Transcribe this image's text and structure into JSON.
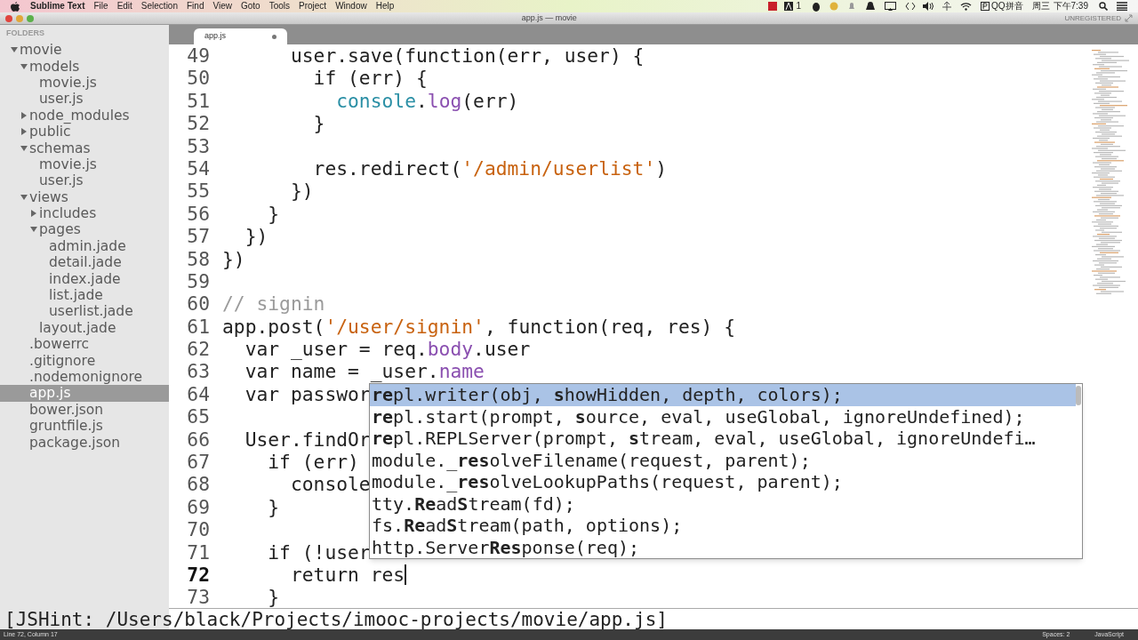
{
  "menu_bar": {
    "app": "Sublime Text",
    "items": [
      "File",
      "Edit",
      "Selection",
      "Find",
      "View",
      "Goto",
      "Tools",
      "Project",
      "Window",
      "Help"
    ],
    "tray_badge": "1",
    "input_method": "QQ拼音",
    "day": "周三",
    "time": "下午7:39"
  },
  "window": {
    "title": "app.js — movie",
    "license": "UNREGISTERED"
  },
  "sidebar": {
    "header": "FOLDERS",
    "items": [
      {
        "label": "movie",
        "kind": "folder",
        "expanded": true,
        "selected": false,
        "children": [
          {
            "label": "models",
            "kind": "folder",
            "expanded": true,
            "selected": false,
            "children": [
              {
                "label": "movie.js",
                "kind": "file",
                "selected": false
              },
              {
                "label": "user.js",
                "kind": "file",
                "selected": false
              }
            ]
          },
          {
            "label": "node_modules",
            "kind": "folder",
            "expanded": false,
            "selected": false
          },
          {
            "label": "public",
            "kind": "folder",
            "expanded": false,
            "selected": false
          },
          {
            "label": "schemas",
            "kind": "folder",
            "expanded": true,
            "selected": false,
            "children": [
              {
                "label": "movie.js",
                "kind": "file",
                "selected": false
              },
              {
                "label": "user.js",
                "kind": "file",
                "selected": false
              }
            ]
          },
          {
            "label": "views",
            "kind": "folder",
            "expanded": true,
            "selected": false,
            "children": [
              {
                "label": "includes",
                "kind": "folder",
                "expanded": false,
                "selected": false
              },
              {
                "label": "pages",
                "kind": "folder",
                "expanded": true,
                "selected": false,
                "children": [
                  {
                    "label": "admin.jade",
                    "kind": "file",
                    "selected": false
                  },
                  {
                    "label": "detail.jade",
                    "kind": "file",
                    "selected": false
                  },
                  {
                    "label": "index.jade",
                    "kind": "file",
                    "selected": false
                  },
                  {
                    "label": "list.jade",
                    "kind": "file",
                    "selected": false
                  },
                  {
                    "label": "userlist.jade",
                    "kind": "file",
                    "selected": false
                  }
                ]
              },
              {
                "label": "layout.jade",
                "kind": "file",
                "selected": false
              }
            ]
          },
          {
            "label": ".bowerrc",
            "kind": "file",
            "selected": false
          },
          {
            "label": ".gitignore",
            "kind": "file",
            "selected": false
          },
          {
            "label": ".nodemonignore",
            "kind": "file",
            "selected": false
          },
          {
            "label": "app.js",
            "kind": "file",
            "selected": true
          },
          {
            "label": "bower.json",
            "kind": "file",
            "selected": false
          },
          {
            "label": "gruntfile.js",
            "kind": "file",
            "selected": false
          },
          {
            "label": "package.json",
            "kind": "file",
            "selected": false
          }
        ]
      }
    ]
  },
  "tabs": [
    {
      "label": "app.js",
      "selected": true
    }
  ],
  "editor": {
    "lines": [
      {
        "no": "49",
        "current": false,
        "tokens": [
          {
            "kind": "plain",
            "text": "      user.save(function(err, user) {"
          }
        ]
      },
      {
        "no": "50",
        "current": false,
        "tokens": [
          {
            "kind": "plain",
            "text": "        if (err) {"
          }
        ]
      },
      {
        "no": "51",
        "current": false,
        "tokens": [
          {
            "kind": "builtin",
            "text": "          console"
          },
          {
            "kind": "plain",
            "text": "."
          },
          {
            "kind": "method",
            "text": "log"
          },
          {
            "kind": "plain",
            "text": "(err)"
          }
        ]
      },
      {
        "no": "52",
        "current": false,
        "tokens": [
          {
            "kind": "plain",
            "text": "        }"
          }
        ]
      },
      {
        "no": "53",
        "current": false
      },
      {
        "no": "54",
        "current": false,
        "tokens": [
          {
            "kind": "plain",
            "text": "        res.redirect("
          },
          {
            "kind": "string",
            "text": "'/admin/userlist'"
          },
          {
            "kind": "plain",
            "text": ")"
          }
        ]
      },
      {
        "no": "55",
        "current": false,
        "tokens": [
          {
            "kind": "plain",
            "text": "      })"
          }
        ]
      },
      {
        "no": "56",
        "current": false,
        "tokens": [
          {
            "kind": "plain",
            "text": "    }"
          }
        ]
      },
      {
        "no": "57",
        "current": false,
        "tokens": [
          {
            "kind": "plain",
            "text": "  })"
          }
        ]
      },
      {
        "no": "58",
        "current": false,
        "tokens": [
          {
            "kind": "plain",
            "text": "})"
          }
        ]
      },
      {
        "no": "59",
        "current": false
      },
      {
        "no": "60",
        "current": false,
        "tokens": [
          {
            "kind": "comment",
            "text": "// signin"
          }
        ]
      },
      {
        "no": "61",
        "current": false,
        "tokens": [
          {
            "kind": "plain",
            "text": "app.post("
          },
          {
            "kind": "string",
            "text": "'/user/signin'"
          },
          {
            "kind": "plain",
            "text": ", function(req, res) {"
          }
        ]
      },
      {
        "no": "62",
        "current": false,
        "tokens": [
          {
            "kind": "plain",
            "text": "  var _user = req."
          },
          {
            "kind": "prop",
            "text": "body"
          },
          {
            "kind": "plain",
            "text": ".user"
          }
        ]
      },
      {
        "no": "63",
        "current": false,
        "tokens": [
          {
            "kind": "plain",
            "text": "  var name = _user."
          },
          {
            "kind": "prop",
            "text": "name"
          }
        ]
      },
      {
        "no": "64",
        "current": false,
        "tokens": [
          {
            "kind": "plain",
            "text": "  var passwor"
          }
        ]
      },
      {
        "no": "65",
        "current": false
      },
      {
        "no": "66",
        "current": false,
        "tokens": [
          {
            "kind": "plain",
            "text": "  User.findOr"
          }
        ]
      },
      {
        "no": "67",
        "current": false,
        "tokens": [
          {
            "kind": "plain",
            "text": "    if (err)"
          }
        ]
      },
      {
        "no": "68",
        "current": false,
        "tokens": [
          {
            "kind": "plain",
            "text": "      console"
          }
        ]
      },
      {
        "no": "69",
        "current": false,
        "tokens": [
          {
            "kind": "plain",
            "text": "    }"
          }
        ]
      },
      {
        "no": "70",
        "current": false
      },
      {
        "no": "71",
        "current": false,
        "tokens": [
          {
            "kind": "plain",
            "text": "    if (!user"
          }
        ]
      },
      {
        "no": "72",
        "current": true,
        "tokens": [
          {
            "kind": "plain",
            "text": "      return res"
          }
        ]
      },
      {
        "no": "73",
        "current": false,
        "tokens": [
          {
            "kind": "plain",
            "text": "    }"
          }
        ]
      }
    ]
  },
  "completions": [
    {
      "text": "**re**pl.writer(obj, **s**howHidden, depth, colors);",
      "selected": true
    },
    {
      "text": "**re**pl.start(prompt, **s**ource, eval, useGlobal, ignoreUndefined);",
      "selected": false
    },
    {
      "text": "**re**pl.REPLServer(prompt, **s**tream, eval, useGlobal, ignoreUndefi…",
      "selected": false
    },
    {
      "text": "module._**res**olveFilename(request, parent);",
      "selected": false
    },
    {
      "text": "module._**res**olveLookupPaths(request, parent);",
      "selected": false
    },
    {
      "text": "tty.**Re**ad**S**tream(fd);",
      "selected": false
    },
    {
      "text": "fs.**Re**ad**S**tream(path, options);",
      "selected": false
    },
    {
      "text": "http.Server**Res**ponse(req);",
      "selected": false
    }
  ],
  "console": {
    "text": "[JSHint: /Users/black/Projects/imooc-projects/movie/app.js]"
  },
  "status_bar": {
    "position": "Line 72, Column 17",
    "indent": "Spaces: 2",
    "syntax": "JavaScript"
  }
}
